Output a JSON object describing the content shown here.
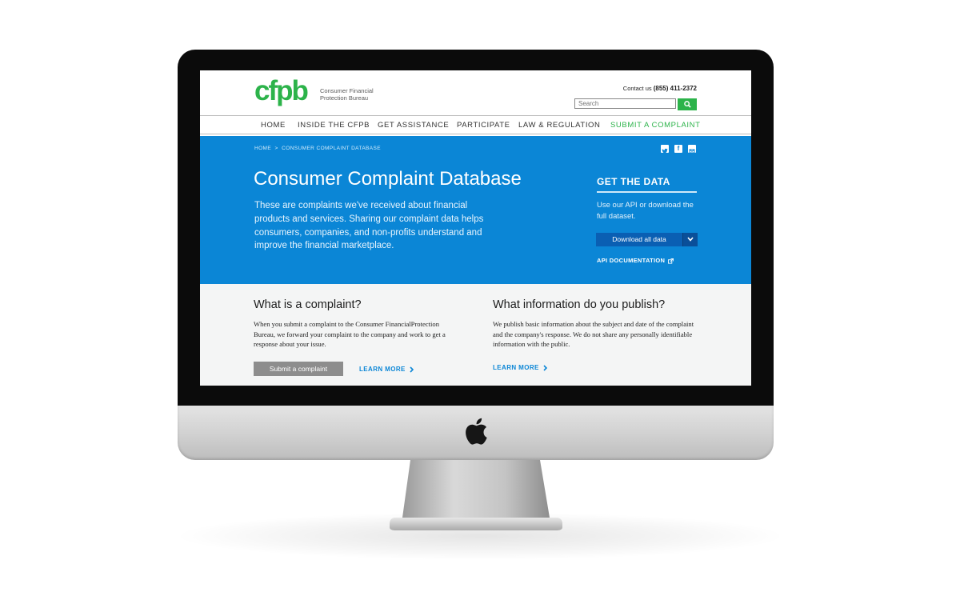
{
  "logo": {
    "wordmark": "cfpb",
    "subtitle": "Consumer Financial Protection Bureau"
  },
  "header": {
    "contact_label": "Contact us",
    "contact_phone": "(855) 411-2372",
    "search_placeholder": "Search"
  },
  "nav": {
    "items": [
      {
        "label": "HOME"
      },
      {
        "label": "INSIDE THE CFPB"
      },
      {
        "label": "GET ASSISTANCE"
      },
      {
        "label": "PARTICIPATE"
      },
      {
        "label": "LAW & REGULATION"
      },
      {
        "label": "SUBMIT A COMPLAINT"
      }
    ]
  },
  "breadcrumb": {
    "home": "HOME",
    "separator": ">",
    "current": "CONSUMER COMPLAINT DATABASE"
  },
  "social": {
    "twitter": "twitter-icon",
    "facebook": "facebook-icon",
    "email": "email-icon"
  },
  "hero": {
    "title": "Consumer Complaint Database",
    "description": "These are complaints we've received about financial products and services. Sharing our complaint data helps consumers, companies, and non-profits understand and improve the financial marketplace."
  },
  "get_data": {
    "title": "GET THE DATA",
    "description": "Use our API or download the full dataset.",
    "download_label": "Download all data",
    "api_label": "API DOCUMENTATION"
  },
  "what_is": {
    "title": "What is a complaint?",
    "body": "When you submit a complaint to the Consumer FinancialProtection Bureau, we forward your complaint to the company and work to get a response about your issue.",
    "button_label": "Submit a complaint",
    "learn_more": "LEARN MORE"
  },
  "what_publish": {
    "title": "What information do you publish?",
    "body": "We publish basic information about the subject and date of the complaint and the company's response. We do not share any personally identifiable information with the public.",
    "learn_more": "LEARN MORE"
  },
  "colors": {
    "brand_green": "#2cb34a",
    "hero_blue": "#0b86d6",
    "button_dark_blue": "#0a5fb3",
    "link_blue": "#0b86d6"
  }
}
